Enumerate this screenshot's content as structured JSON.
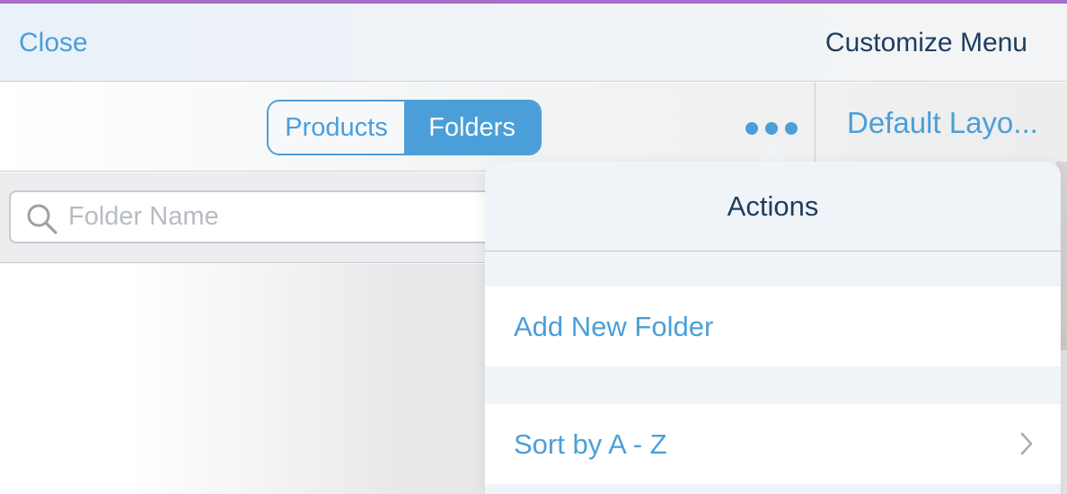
{
  "navbar": {
    "close_label": "Close",
    "title": "Customize Menu"
  },
  "toolbar": {
    "segments": [
      {
        "label": "Products",
        "selected": false
      },
      {
        "label": "Folders",
        "selected": true
      }
    ],
    "more_icon": "ellipsis-icon",
    "layout_label": "Default Layo..."
  },
  "search": {
    "placeholder": "Folder Name",
    "value": "",
    "icon": "search-icon"
  },
  "popover": {
    "title": "Actions",
    "actions": [
      {
        "label": "Add New Folder",
        "has_chevron": false
      },
      {
        "label": "Sort by A - Z",
        "has_chevron": true
      }
    ]
  },
  "colors": {
    "accent": "#4a9fd8",
    "title_text": "#1d3d5e",
    "top_line": "#a86cc9",
    "popover_bg": "#f0f4f8"
  }
}
